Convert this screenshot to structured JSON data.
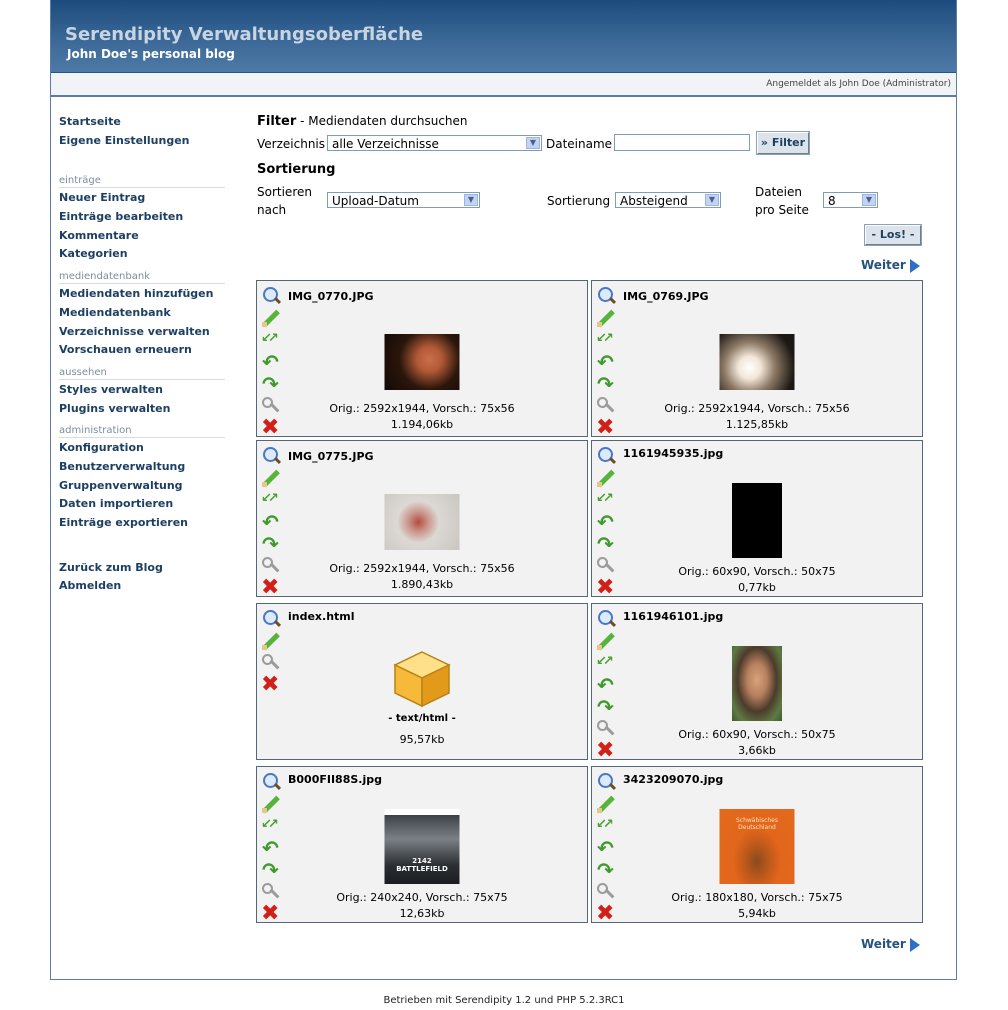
{
  "header": {
    "title": "Serendipity Verwaltungsoberfläche",
    "subtitle": "John Doe's personal blog",
    "logged_in": "Angemeldet als John Doe (Administrator)"
  },
  "sidebar": {
    "top": [
      "Startseite",
      "Eigene Einstellungen"
    ],
    "sections": [
      {
        "title": "einträge",
        "items": [
          "Neuer Eintrag",
          "Einträge bearbeiten",
          "Kommentare",
          "Kategorien"
        ]
      },
      {
        "title": "mediendatenbank",
        "items": [
          "Mediendaten hinzufügen",
          "Mediendatenbank",
          "Verzeichnisse verwalten",
          "Vorschauen erneuern"
        ]
      },
      {
        "title": "aussehen",
        "items": [
          "Styles verwalten",
          "Plugins verwalten"
        ]
      },
      {
        "title": "administration",
        "items": [
          "Konfiguration",
          "Benutzerverwaltung",
          "Gruppenverwaltung",
          "Daten importieren",
          "Einträge exportieren"
        ]
      }
    ],
    "bottom": [
      "Zurück zum Blog",
      "Abmelden"
    ]
  },
  "filter": {
    "title": "Filter",
    "subtitle": " - Mediendaten durchsuchen",
    "dir_label": "Verzeichnis",
    "dir_value": "alle Verzeichnisse",
    "filename_label": "Dateiname",
    "filename_value": "",
    "button": "» Filter"
  },
  "sort": {
    "title": "Sortierung",
    "by_label_1": "Sortieren",
    "by_label_2": "nach",
    "by_value": "Upload-Datum",
    "order_label": "Sortierung",
    "order_value": "Absteigend",
    "per_page_label_1": "Dateien",
    "per_page_label_2": "pro Seite",
    "per_page_value": "8",
    "go_button": "- Los! -"
  },
  "pager": {
    "next": "Weiter"
  },
  "media": [
    {
      "name": "IMG_0770.JPG",
      "orig": "Orig.: 2592x1944, Vorsch.: 75x56",
      "size": "1.194,06kb"
    },
    {
      "name": "IMG_0769.JPG",
      "orig": "Orig.: 2592x1944, Vorsch.: 75x56",
      "size": "1.125,85kb"
    },
    {
      "name": "IMG_0775.JPG",
      "orig": "Orig.: 2592x1944, Vorsch.: 75x56",
      "size": "1.890,43kb"
    },
    {
      "name": "1161945935.jpg",
      "orig": "Orig.: 60x90, Vorsch.: 50x75",
      "size": "0,77kb"
    },
    {
      "name": "index.html",
      "mime": "- text/html -",
      "size": "95,57kb"
    },
    {
      "name": "1161946101.jpg",
      "orig": "Orig.: 60x90, Vorsch.: 50x75",
      "size": "3,66kb"
    },
    {
      "name": "B000FII88S.jpg",
      "orig": "Orig.: 240x240, Vorsch.: 75x75",
      "size": "12,63kb"
    },
    {
      "name": "3423209070.jpg",
      "orig": "Orig.: 180x180, Vorsch.: 75x75",
      "size": "5,94kb"
    }
  ],
  "thumb_labels": {
    "game_line1": "2142",
    "game_line2": "BATTLEFIELD",
    "book": "Schwäbisches Deutschland"
  },
  "footer": "Betrieben mit Serendipity 1.2 und PHP 5.2.3RC1",
  "colors": {
    "header": "#3d6a98",
    "link": "#1d3f63",
    "cell_bg": "#f2f2f2"
  }
}
